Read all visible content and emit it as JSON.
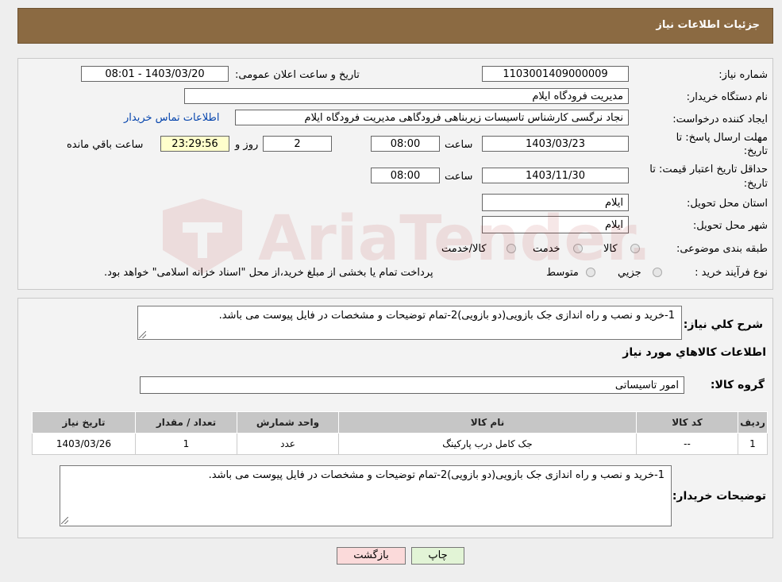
{
  "header": {
    "title": "جزئیات اطلاعات نیاز"
  },
  "form": {
    "need_number_label": "شماره نیاز:",
    "need_number": "1103001409000009",
    "announce_label": "تاریخ و ساعت اعلان عمومی:",
    "announce_value": "1403/03/20 - 08:01",
    "buyer_org_label": "نام دستگاه خریدار:",
    "buyer_org": "مدیریت فرودگاه ایلام",
    "creator_label": "ایجاد کننده درخواست:",
    "creator": "نجاد نرگسی کارشناس تاسیسات زیربناهی فرودگاهی مدیریت فرودگاه ایلام",
    "contact_link": "اطلاعات تماس خریدار",
    "deadline_label_1": "مهلت ارسال پاسخ: تا",
    "deadline_label_2": "تاریخ:",
    "deadline_date": "1403/03/23",
    "time_label": "ساعت",
    "deadline_time": "08:00",
    "days_value": "2",
    "days_label": "روز و",
    "remaining_time": "23:29:56",
    "remaining_label": "ساعت باقي مانده",
    "validity_label_1": "حداقل تاریخ اعتبار قیمت: تا",
    "validity_label_2": "تاریخ:",
    "validity_date": "1403/11/30",
    "validity_time": "08:00",
    "province_label": "استان محل تحویل:",
    "province": "ایلام",
    "city_label": "شهر محل تحویل:",
    "city": "ایلام",
    "category_label": "طبقه بندی موضوعی:",
    "category_options": [
      "کالا",
      "خدمت",
      "کالا/خدمت"
    ],
    "process_label": "نوع فرآیند خرید :",
    "process_options": [
      "جزيي",
      "متوسط"
    ],
    "process_note": "پرداخت تمام یا بخشی از مبلغ خرید،از محل \"اسناد خزانه اسلامی\" خواهد بود."
  },
  "summary": {
    "label": "شرح كلي نياز:",
    "text": "1-خرید و نصب و راه اندازی جک بازویی(دو بازویی)2-تمام توضیحات و مشخصات در فایل پیوست می باشد.",
    "goods_info_title": "اطلاعات كالاهاي مورد نياز",
    "group_label": "گروه كالا:",
    "group_value": "امور تاسیساتی"
  },
  "table": {
    "headers": [
      "رديف",
      "كد كالا",
      "نام كالا",
      "واحد شمارش",
      "تعداد / مقدار",
      "تاريخ نياز"
    ],
    "rows": [
      [
        "1",
        "--",
        "جک کامل درب پارکینگ",
        "عدد",
        "1",
        "1403/03/26"
      ]
    ]
  },
  "buyer_notes": {
    "label": "توضیحات خریدار:",
    "text": "1-خرید و نصب و راه اندازی جک بازویی(دو بازویی)2-تمام توضیحات و مشخصات در فایل پیوست می باشد."
  },
  "buttons": {
    "print": "چاپ",
    "back": "بازگشت"
  },
  "watermark": {
    "text": "AriaTender.neT",
    "color": "#b22222"
  }
}
